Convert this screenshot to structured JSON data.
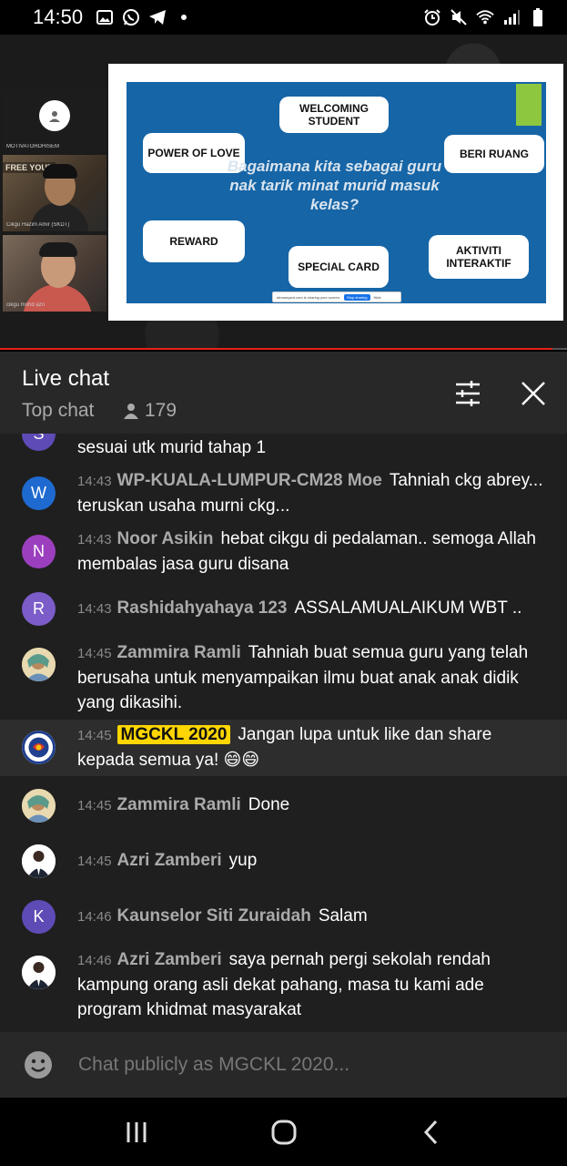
{
  "status_bar": {
    "time": "14:50",
    "left_icons": [
      "gallery-icon",
      "whatsapp-icon",
      "telegram-icon",
      "notification-dot-icon"
    ],
    "right_icons": [
      "alarm-icon",
      "mute-icon",
      "wifi-icon",
      "signal-icon",
      "battery-icon"
    ]
  },
  "video": {
    "participants": [
      {
        "name": "MOTIVATORDHISEM"
      },
      {
        "name": "Cikgu Hazim Amir (SKDT)",
        "banner": "FREE YOUR"
      },
      {
        "name": "cikgu mohd azri"
      }
    ],
    "slide": {
      "question": "Bagaimana kita sebagai guru nak tarik minat murid masuk kelas?",
      "cards": [
        "WELCOMING STUDENT",
        "POWER OF LOVE",
        "BERI RUANG",
        "REWARD",
        "SPECIAL CARD",
        "AKTIVITI INTERAKTIF"
      ],
      "share_notice": "streamyard.com is sharing your screen.",
      "stop_sharing": "Stop sharing",
      "hide": "Hide"
    },
    "progress": 0.975,
    "colors": {
      "progress": "#e62117",
      "slide_bg": "#1665a6",
      "accent_tab": "#8dc63f"
    }
  },
  "chat_header": {
    "title": "Live chat",
    "mode": "Top chat",
    "viewer_count": "179"
  },
  "messages": [
    {
      "initial": "S",
      "avatar_color": "#5e4bb5",
      "time": "",
      "author": "",
      "text": "sesuai utk murid tahap 1"
    },
    {
      "initial": "W",
      "avatar_color": "#1e6ad0",
      "time": "14:43",
      "author": "WP-KUALA-LUMPUR-CM28 Moe",
      "text": "Tahniah ckg abrey... teruskan usaha murni ckg..."
    },
    {
      "initial": "N",
      "avatar_color": "#9c3fbf",
      "time": "14:43",
      "author": "Noor Asikin",
      "text": "hebat cikgu di pedalaman.. semoga Allah membalas jasa guru disana"
    },
    {
      "initial": "R",
      "avatar_color": "#7b5cc8",
      "time": "14:43",
      "author": "Rashidahyahaya 123",
      "text": "ASSALAMUALAIKUM WBT .."
    },
    {
      "initial": "",
      "avatar_color": "#c9a86a",
      "time": "14:45",
      "author": "Zammira Ramli",
      "text": "Tahniah buat semua guru yang telah berusaha untuk menyampaikan ilmu buat anak anak didik yang dikasihi."
    },
    {
      "initial": "",
      "avatar_color": "#ffffff",
      "time": "14:45",
      "author": "MGCKL 2020",
      "text": "Jangan lupa untuk like dan share kepada semua ya! 😄😄",
      "is_owner_badge": true
    },
    {
      "initial": "",
      "avatar_color": "#c9a86a",
      "time": "14:45",
      "author": "Zammira Ramli",
      "text": "Done"
    },
    {
      "initial": "",
      "avatar_color": "#ffffff",
      "time": "14:45",
      "author": "Azri Zamberi",
      "text": "yup"
    },
    {
      "initial": "K",
      "avatar_color": "#5e4bb5",
      "time": "14:46",
      "author": "Kaunselor Siti Zuraidah",
      "text": "Salam"
    },
    {
      "initial": "",
      "avatar_color": "#ffffff",
      "time": "14:46",
      "author": "Azri Zamberi",
      "text": "saya pernah pergi sekolah rendah kampung orang asli dekat pahang, masa tu kami ade program khidmat masyarakat"
    }
  ],
  "input": {
    "placeholder": "Chat publicly as MGCKL 2020..."
  },
  "nav": {
    "buttons": [
      "recent-apps-icon",
      "home-icon",
      "back-icon"
    ]
  }
}
